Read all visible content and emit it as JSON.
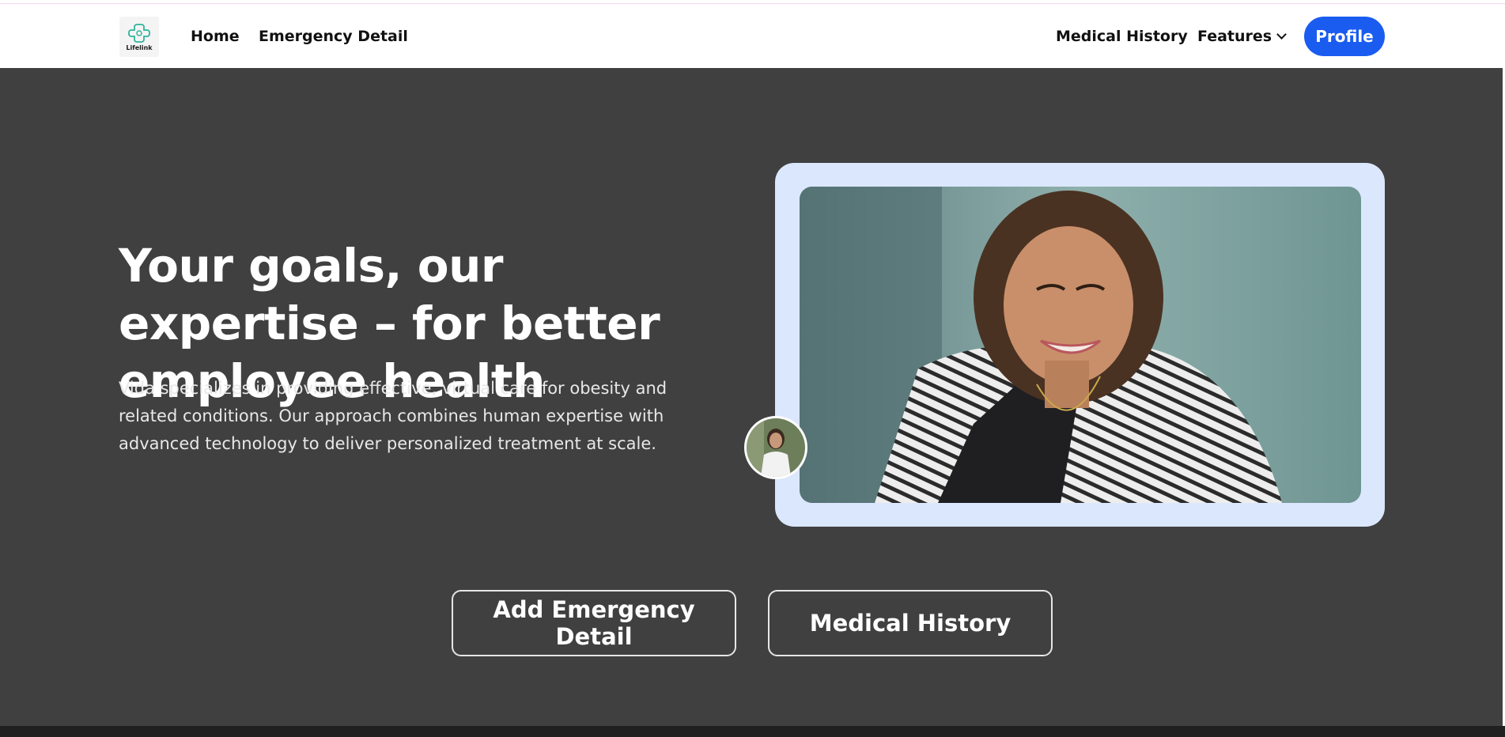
{
  "brand": {
    "logo_text": "Lifelink"
  },
  "nav": {
    "home": "Home",
    "emergency_detail": "Emergency Detail",
    "medical_history": "Medical History",
    "features": "Features",
    "profile": "Profile"
  },
  "hero": {
    "title": "Your goals, our expertise – for better employee health",
    "description": "Vida specializes in providing effective, virtual care for obesity and related conditions. Our approach combines human expertise with advanced technology to deliver personalized treatment at scale."
  },
  "actions": {
    "add_emergency": "Add Emergency Detail",
    "medical_history": "Medical History"
  },
  "colors": {
    "background": "#404040",
    "navbar": "#ffffff",
    "accent": "#1a5cf0",
    "frame": "#dbe7fc"
  },
  "icons": {
    "logo": "medical-cross-logo-icon",
    "features_dropdown": "chevron-down-icon"
  }
}
